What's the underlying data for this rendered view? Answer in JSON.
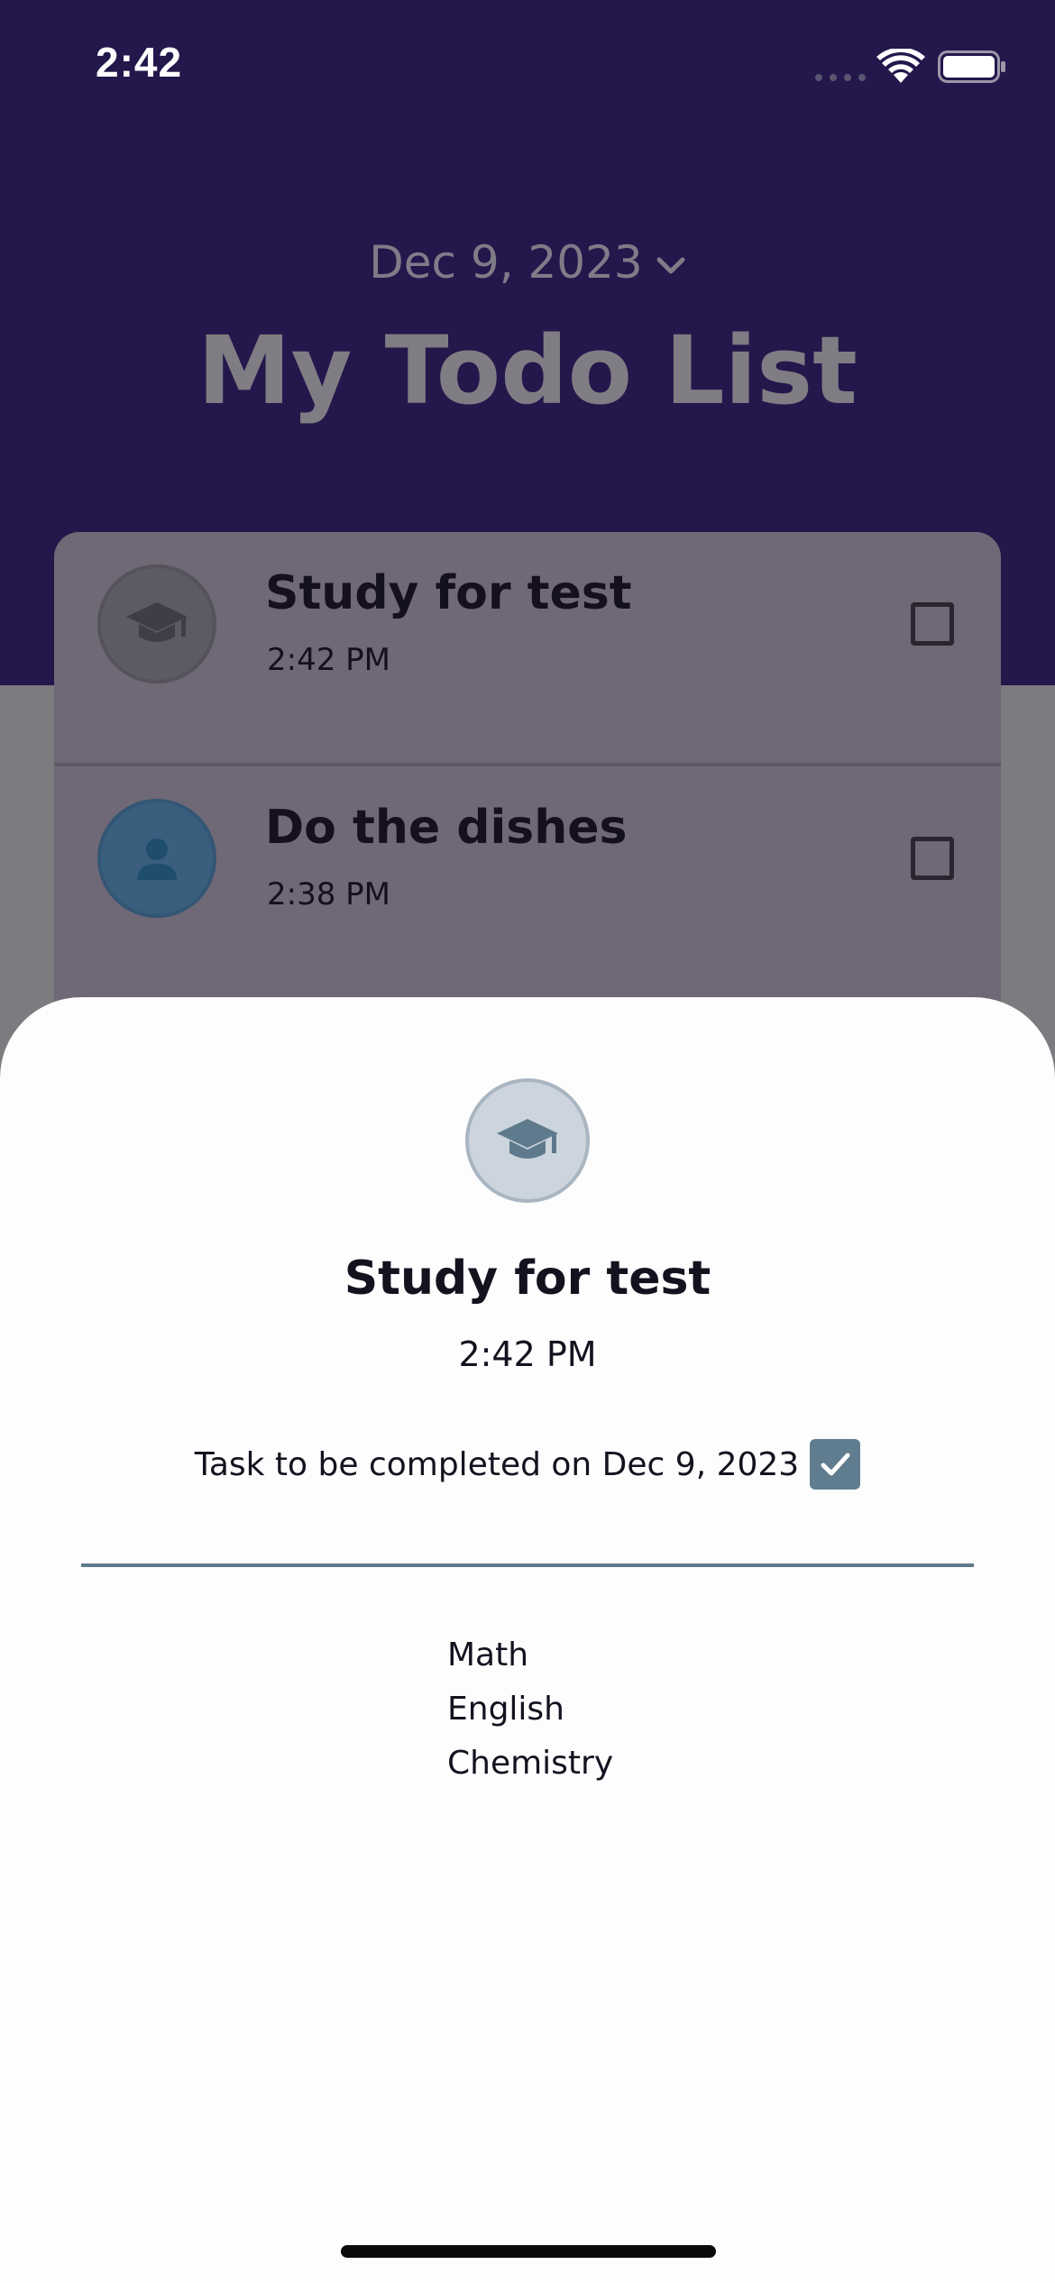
{
  "status_bar": {
    "time": "2:42"
  },
  "header": {
    "date": "Dec 9, 2023",
    "title": "My Todo List"
  },
  "todos": [
    {
      "title": "Study for test",
      "time": "2:42 PM",
      "icon": "graduation-cap-icon",
      "completed": false
    },
    {
      "title": "Do the dishes",
      "time": "2:38 PM",
      "icon": "person-icon",
      "completed": false
    }
  ],
  "sheet": {
    "title": "Study for test",
    "time": "2:42 PM",
    "completion_text": "Task to be completed on Dec 9, 2023",
    "completed": true,
    "icon": "graduation-cap-icon",
    "subjects": [
      "Math",
      "English",
      "Chemistry"
    ]
  },
  "colors": {
    "header_bg": "#23174c",
    "accent": "#5f7d8f"
  }
}
